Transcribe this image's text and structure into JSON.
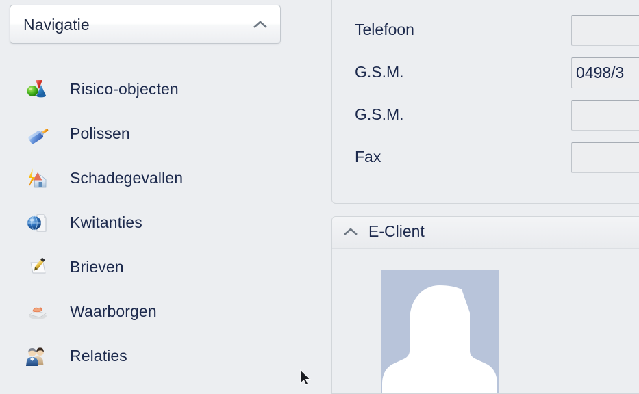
{
  "navigation": {
    "header_title": "Navigatie",
    "collapse_icon": "chevron-up-icon",
    "items": [
      {
        "label": "Risico-objecten",
        "icon": "shapes-icon"
      },
      {
        "label": "Polissen",
        "icon": "paint-roller-icon"
      },
      {
        "label": "Schadegevallen",
        "icon": "house-lightning-icon"
      },
      {
        "label": "Kwitanties",
        "icon": "globe-document-icon"
      },
      {
        "label": "Brieven",
        "icon": "pen-paper-icon"
      },
      {
        "label": "Waarborgen",
        "icon": "certificate-seal-icon"
      },
      {
        "label": "Relaties",
        "icon": "two-people-icon"
      }
    ]
  },
  "contact_group": {
    "fields": [
      {
        "label": "Telefoon",
        "value": ""
      },
      {
        "label": "G.S.M.",
        "value": "0498/3"
      },
      {
        "label": "G.S.M.",
        "value": ""
      },
      {
        "label": "Fax",
        "value": ""
      }
    ]
  },
  "eclient_group": {
    "title": "E-Client",
    "collapse_icon": "chevron-up-icon",
    "avatar_placeholder": "person-silhouette-icon"
  },
  "colors": {
    "background": "#eceef1",
    "text": "#1d2a4d",
    "panel_border": "#d2d6da",
    "input_background": "#edeef0",
    "avatar_background": "#b8c4da"
  }
}
